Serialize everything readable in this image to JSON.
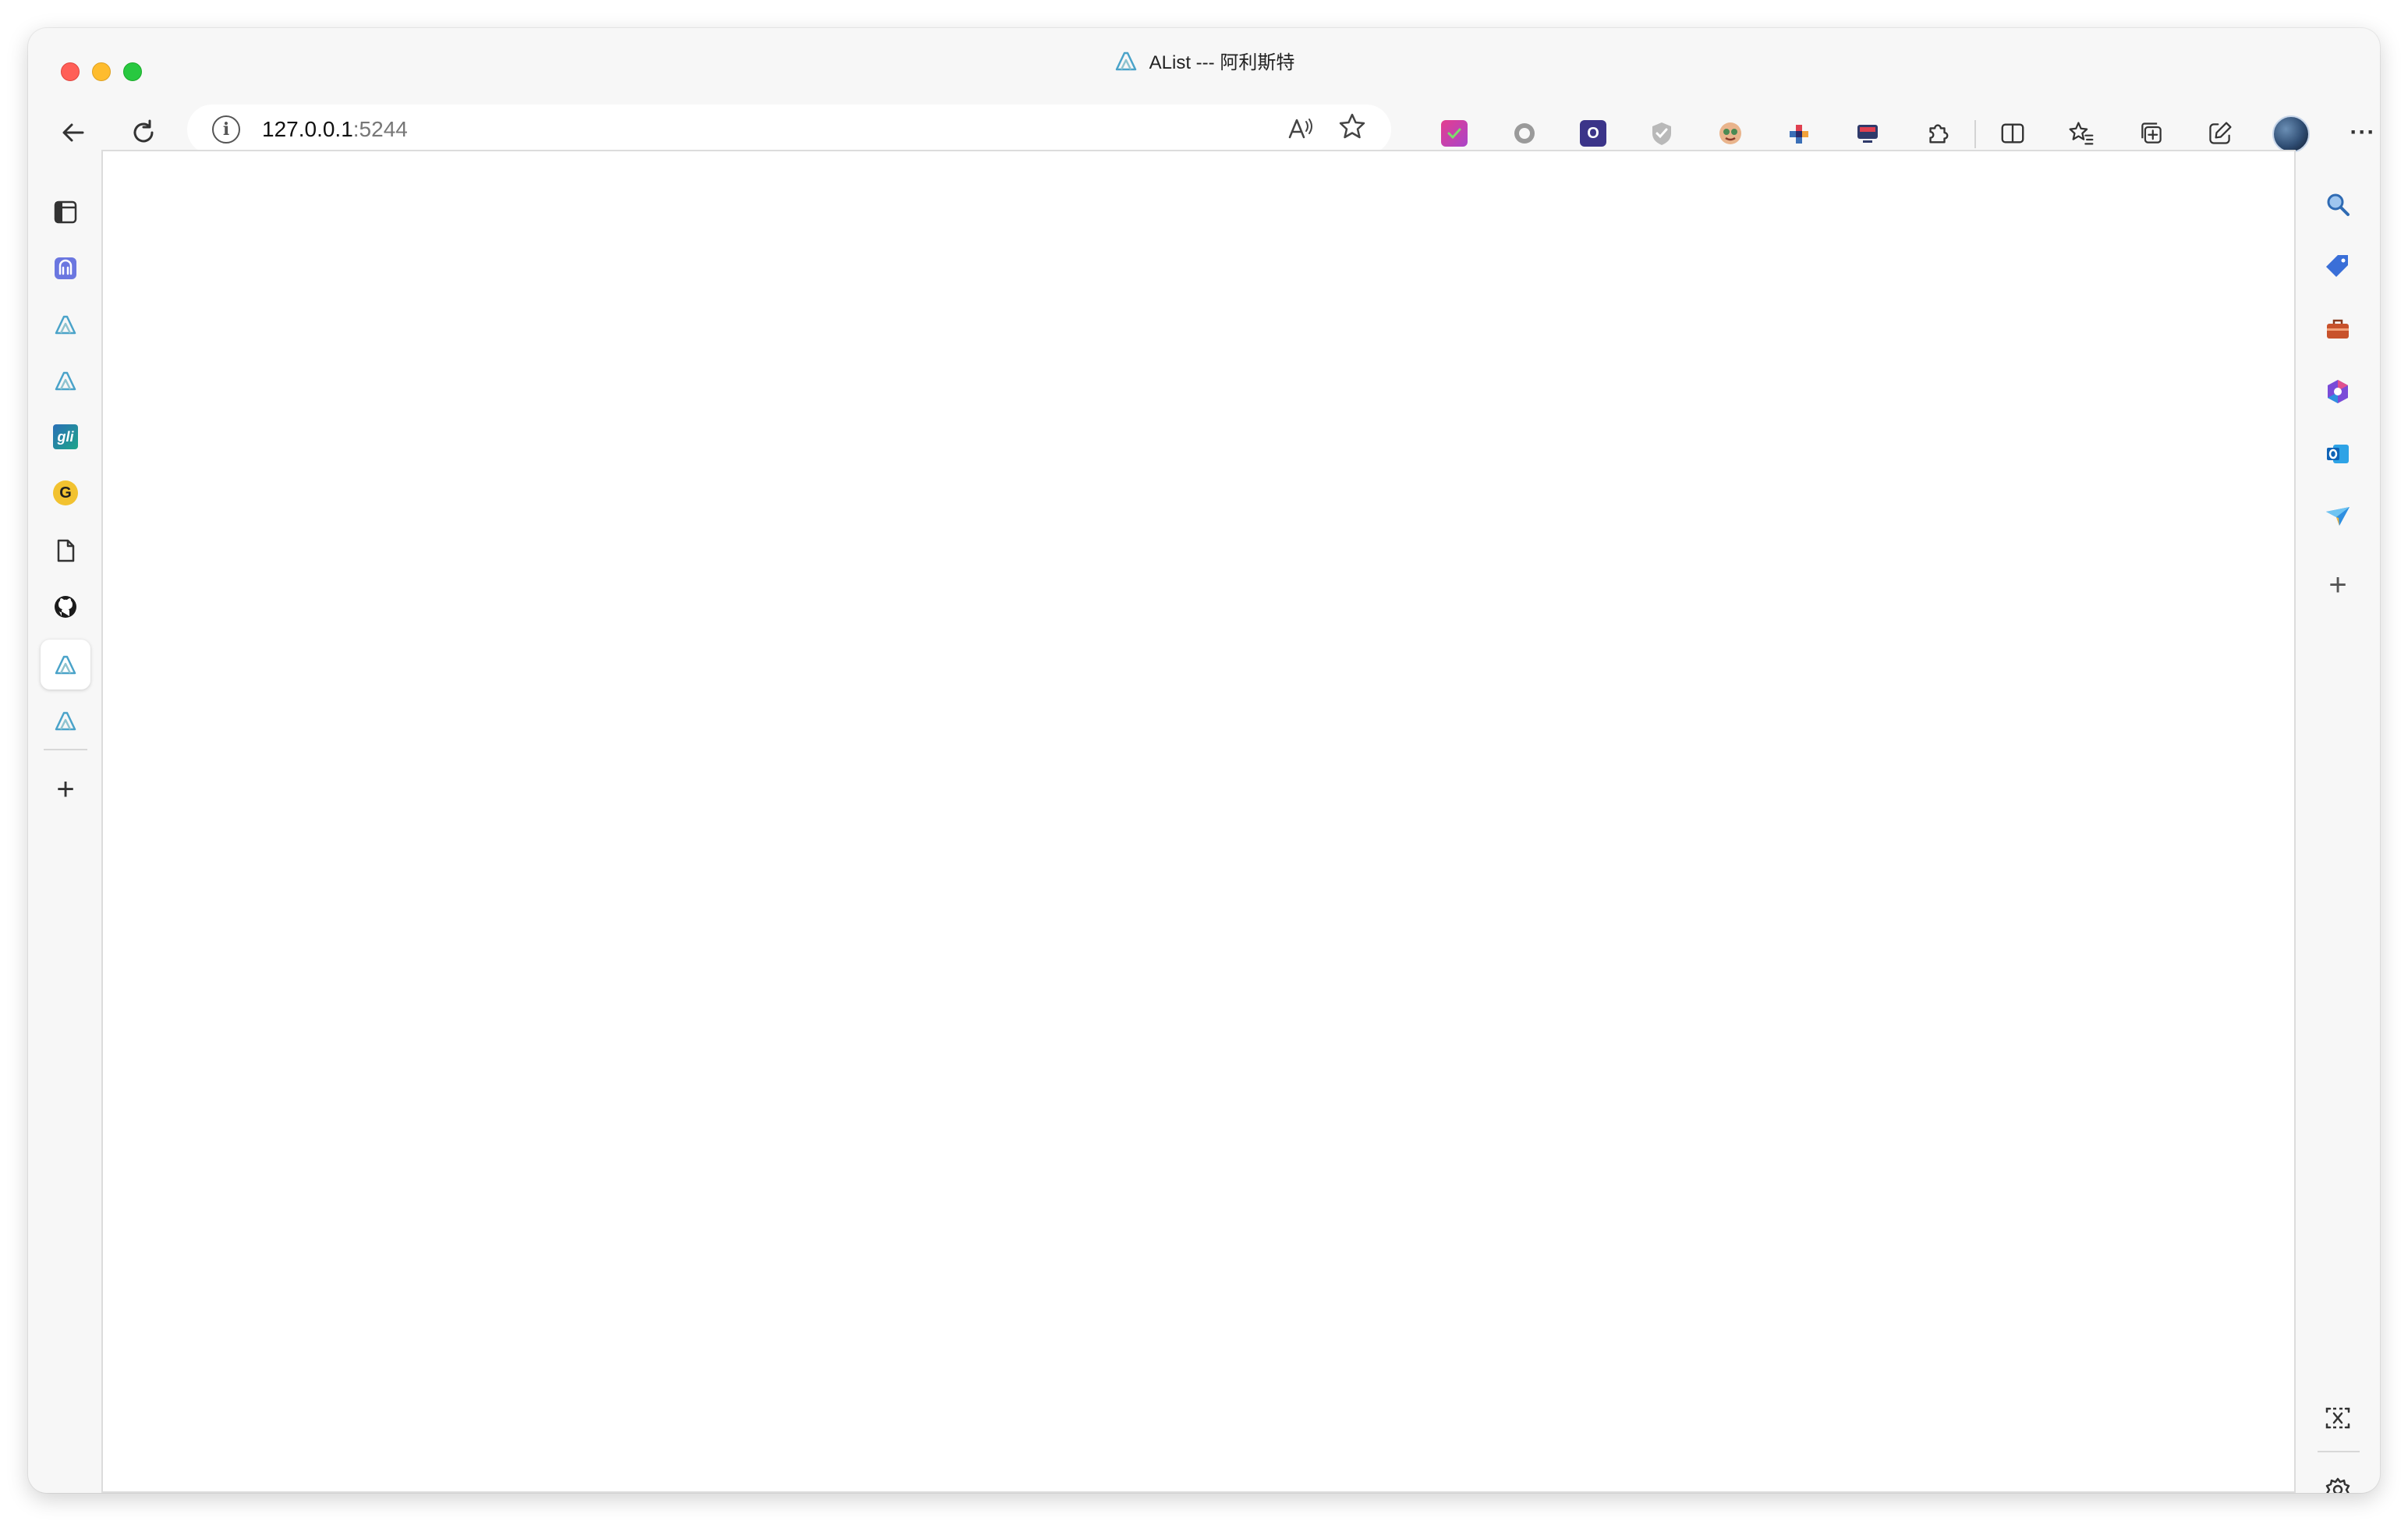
{
  "window": {
    "title": "AList --- 阿利斯特"
  },
  "toolbar": {
    "url_host": "127.0.0.1",
    "url_port": ":5244",
    "back_icon": "back-arrow-icon",
    "refresh_icon": "refresh-icon",
    "site_info_icon": "info-icon",
    "read_aloud_icon": "read-aloud-icon",
    "favorite_icon": "star-icon",
    "extensions": [
      {
        "name": "extension-pink-check-icon",
        "color": "#d9439a"
      },
      {
        "name": "extension-gray-circle-icon",
        "color": "#9a9a9a"
      },
      {
        "name": "extension-purple-o-icon",
        "color": "#3b3489",
        "glyph": "O"
      },
      {
        "name": "extension-shield-icon",
        "color": "#b9b9b9"
      },
      {
        "name": "extension-face-icon",
        "color": "#c97a4a"
      },
      {
        "name": "extension-colorful-icon",
        "color": "#3a6fb7"
      },
      {
        "name": "extension-screen-icon",
        "color": "#e04050"
      }
    ],
    "extensions_icon": "puzzle-icon",
    "split_screen_icon": "split-screen-icon",
    "favorites_icon": "favorites-list-icon",
    "collections_icon": "collections-icon",
    "share_icon": "share-edit-icon",
    "profile_icon": "profile-avatar",
    "more_icon": "more-icon",
    "more_glyph": "···"
  },
  "left_sidebar": {
    "items": [
      {
        "name": "tab-actions-icon",
        "active": false
      },
      {
        "name": "omnivore-icon",
        "active": false
      },
      {
        "name": "alist-icon",
        "active": false
      },
      {
        "name": "alist-icon",
        "active": false
      },
      {
        "name": "gli-icon",
        "active": false,
        "glyph": "gli"
      },
      {
        "name": "grammarly-icon",
        "active": false,
        "glyph": "G"
      },
      {
        "name": "document-icon",
        "active": false
      },
      {
        "name": "github-icon",
        "active": false
      },
      {
        "name": "alist-icon",
        "active": true
      },
      {
        "name": "alist-icon",
        "active": false
      }
    ],
    "add_glyph": "+"
  },
  "right_sidebar": {
    "items": [
      {
        "name": "search-icon"
      },
      {
        "name": "shopping-tag-icon"
      },
      {
        "name": "tools-briefcase-icon"
      },
      {
        "name": "office-icon"
      },
      {
        "name": "outlook-icon"
      },
      {
        "name": "send-icon"
      }
    ],
    "add_glyph": "+",
    "bottom": [
      {
        "name": "screenshot-icon"
      },
      {
        "name": "settings-icon"
      }
    ]
  },
  "colors": {
    "chrome_bg": "#f7f7f7",
    "content_bg": "#ffffff",
    "alist_blue": "#4aa3c9",
    "alist_teal": "#8ec3cf"
  }
}
